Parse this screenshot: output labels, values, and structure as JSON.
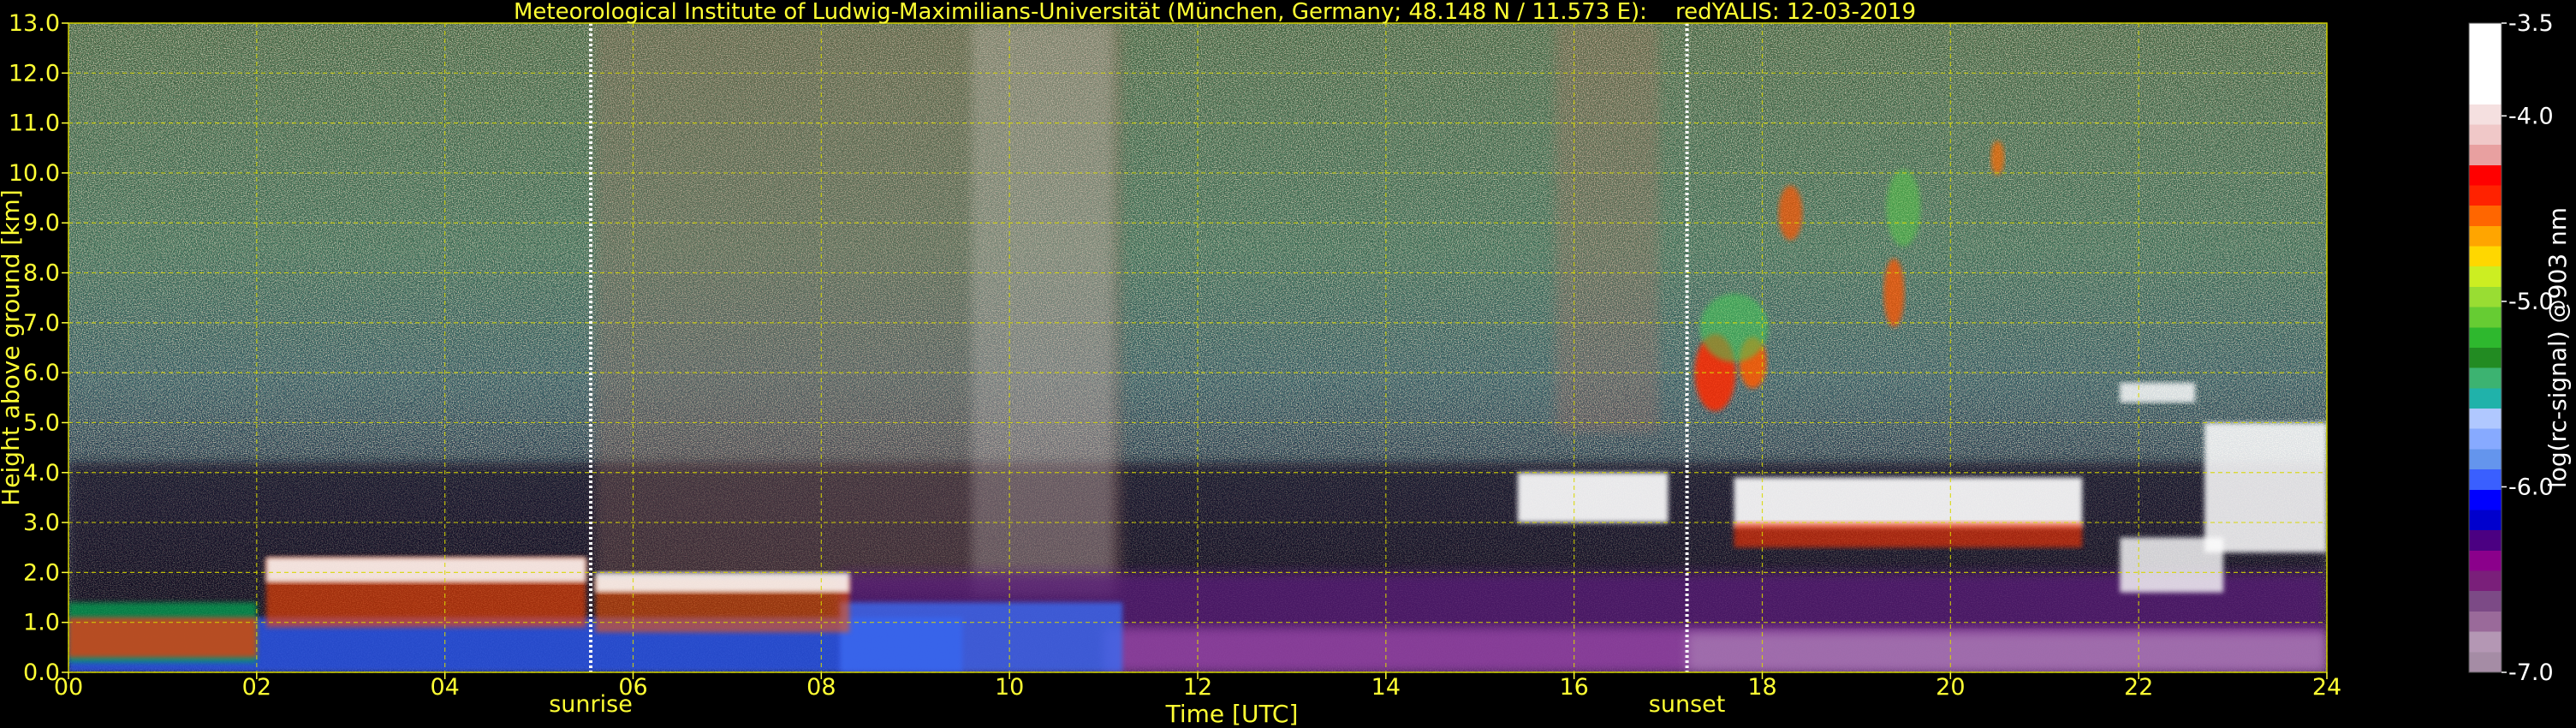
{
  "chart_data": {
    "type": "heatmap",
    "title": "Meteorological Institute of Ludwig-Maximilians-Universität (München, Germany; 48.148 N / 11.573 E):    redYALIS: 12-03-2019",
    "xlabel": "Time [UTC]",
    "ylabel": "Height above ground [km]",
    "xlim": [
      0,
      24
    ],
    "ylim": [
      0,
      13
    ],
    "x_ticks": [
      "00",
      "02",
      "04",
      "06",
      "08",
      "10",
      "12",
      "14",
      "16",
      "18",
      "20",
      "22",
      "24"
    ],
    "y_ticks": [
      "0.0",
      "1.0",
      "2.0",
      "3.0",
      "4.0",
      "5.0",
      "6.0",
      "7.0",
      "8.0",
      "9.0",
      "10.0",
      "11.0",
      "12.0",
      "13.0"
    ],
    "grid": true,
    "annotations": [
      {
        "label": "sunrise",
        "x": 5.55
      },
      {
        "label": "sunset",
        "x": 17.2
      }
    ],
    "colorbar": {
      "label": "log(rc-signal) @903 nm",
      "min": -7.0,
      "max": -3.5,
      "ticks": [
        "-3.5",
        "-4.0",
        "-5.0",
        "-6.0",
        "-7.0"
      ],
      "colors": [
        "#a58ca5",
        "#b497b4",
        "#9a6a9a",
        "#7c4a86",
        "#7a1f7a",
        "#8b008b",
        "#4b0082",
        "#0000cd",
        "#0000ff",
        "#3a5fff",
        "#6495ed",
        "#87aaff",
        "#b0c8ff",
        "#20b2aa",
        "#3cb371",
        "#228b22",
        "#2eb82e",
        "#66cc33",
        "#99dd33",
        "#ccee22",
        "#ffd700",
        "#ffa500",
        "#ff6600",
        "#ff2200",
        "#ff0000",
        "#e8a0a0",
        "#f0c8c8",
        "#f5e0e0",
        "#ffffff",
        "#ffffff",
        "#ffffff",
        "#ffffff"
      ]
    },
    "colors": {
      "text": "#ffff33",
      "axis": "#ffff33",
      "gridline": "#d8d800"
    }
  }
}
